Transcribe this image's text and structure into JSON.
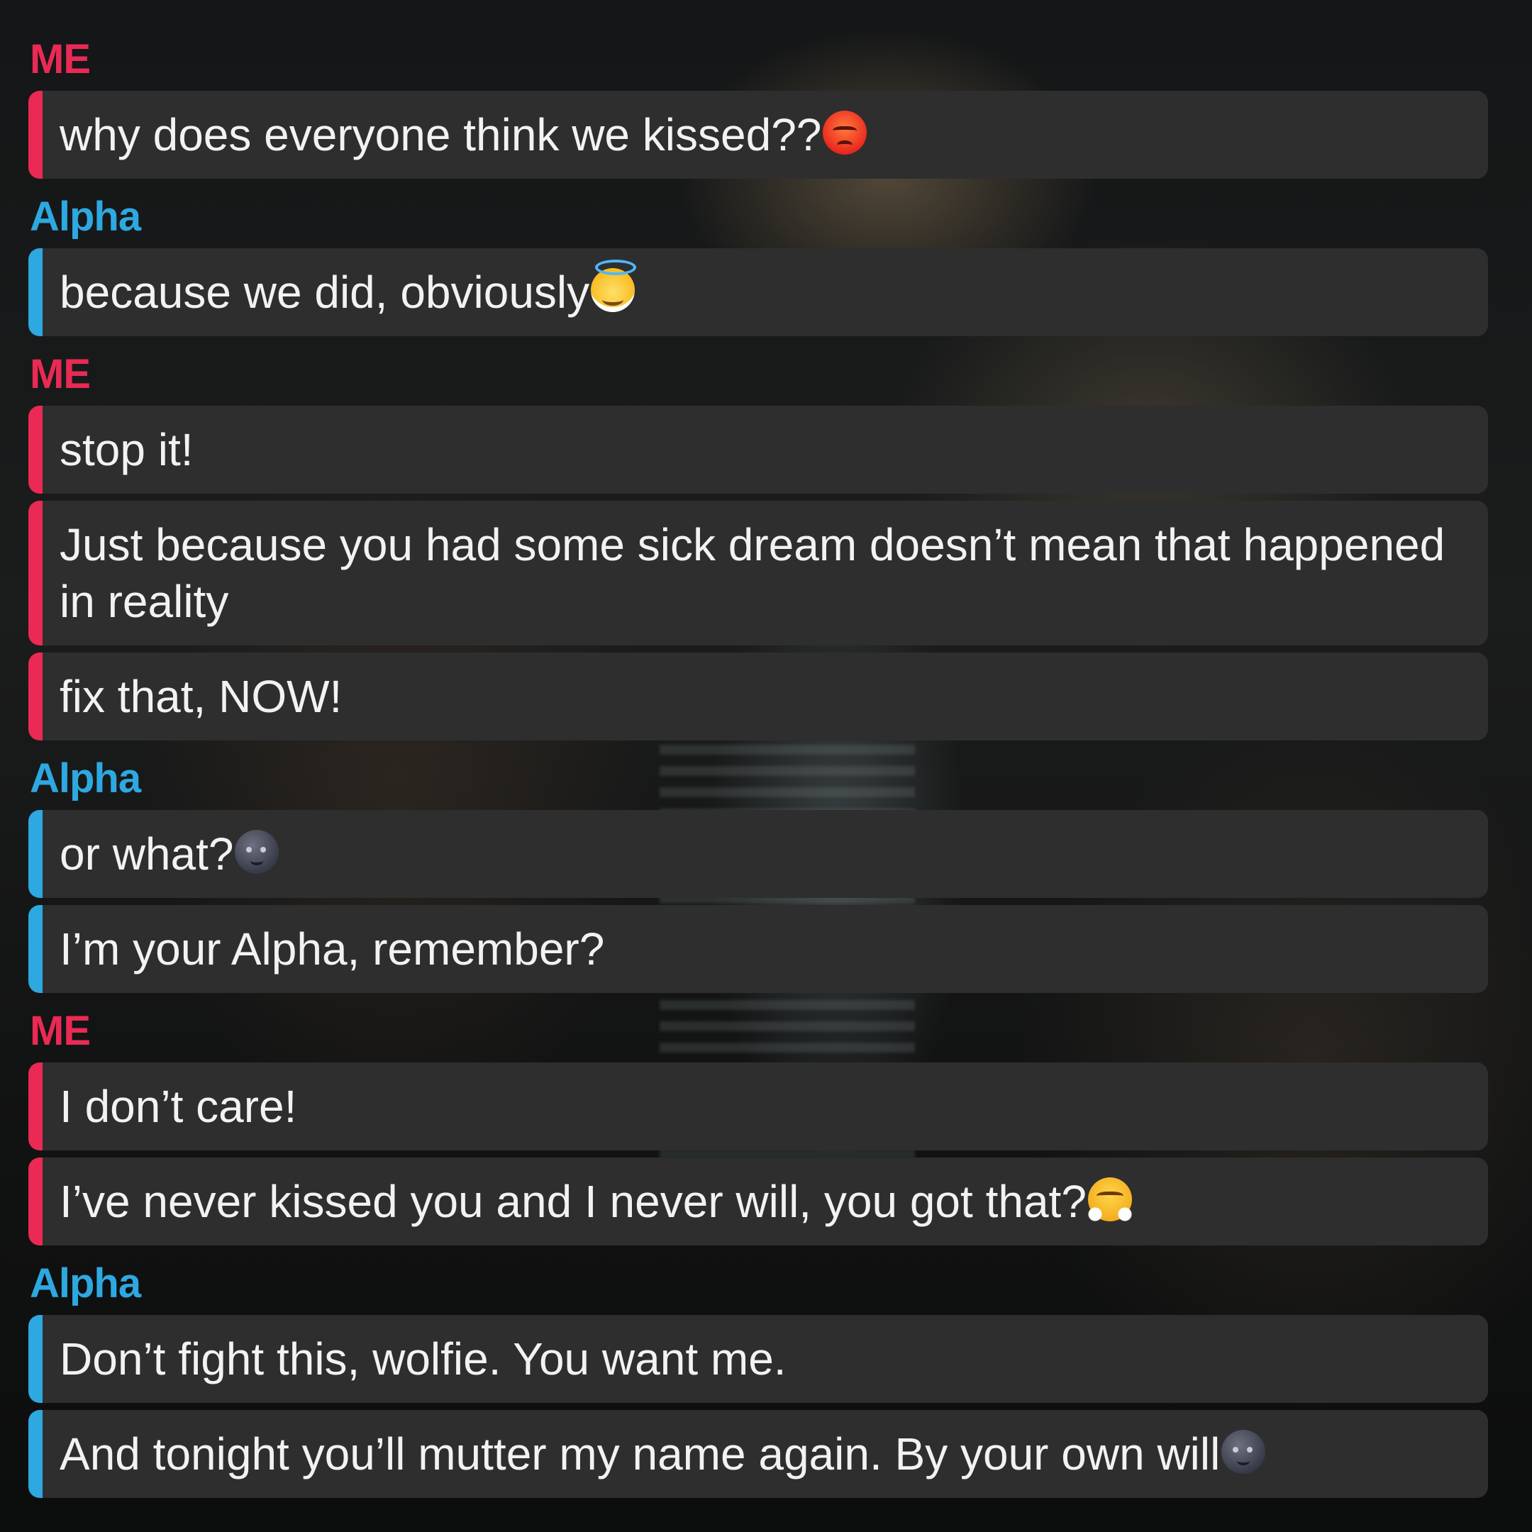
{
  "chat": {
    "groups": [
      {
        "sender": "ME",
        "messages": [
          {
            "text": "why does everyone think we kissed??",
            "emoji": "angry-face"
          }
        ]
      },
      {
        "sender": "Alpha",
        "messages": [
          {
            "text": "because we did, obviously",
            "emoji": "smiling-face-with-halo"
          }
        ]
      },
      {
        "sender": "ME",
        "messages": [
          {
            "text": "stop it!"
          },
          {
            "text": "Just because you had some sick dream doesn’t mean that happened in reality"
          },
          {
            "text": "fix that, NOW!"
          }
        ]
      },
      {
        "sender": "Alpha",
        "messages": [
          {
            "text": "or what?",
            "emoji": "new-moon-face"
          },
          {
            "text": "I’m your Alpha, remember?"
          }
        ]
      },
      {
        "sender": "ME",
        "messages": [
          {
            "text": "I don’t care!"
          },
          {
            "text": "I’ve never kissed you and I never will, you got that?",
            "emoji": "face-with-steam-from-nose"
          }
        ]
      },
      {
        "sender": "Alpha",
        "messages": [
          {
            "text": "Don’t fight this, wolfie. You want me."
          },
          {
            "text": "And tonight you’ll mutter my name again. By your own will",
            "emoji": "new-moon-face"
          }
        ]
      }
    ]
  },
  "colors": {
    "me_accent": "#ea2a54",
    "alpha_accent": "#2ea8e0",
    "bubble_bg": "#2e2e2f",
    "text": "#f2f2f2"
  }
}
